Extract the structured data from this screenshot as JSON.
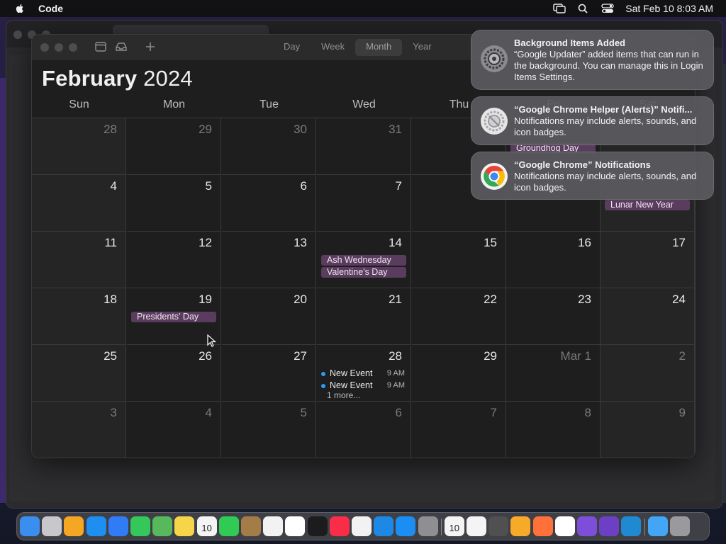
{
  "menubar": {
    "app_name": "Code",
    "clock": "Sat Feb 10  8:03 AM"
  },
  "calendar": {
    "view_tabs": [
      {
        "label": "Day",
        "active": false
      },
      {
        "label": "Week",
        "active": false
      },
      {
        "label": "Month",
        "active": true
      },
      {
        "label": "Year",
        "active": false
      }
    ],
    "month": "February",
    "year": "2024",
    "weekdays": [
      "Sun",
      "Mon",
      "Tue",
      "Wed",
      "Thu",
      "Fri",
      "Sat"
    ],
    "weeks": [
      [
        {
          "day": "28",
          "other": true
        },
        {
          "day": "29",
          "other": true
        },
        {
          "day": "30",
          "other": true
        },
        {
          "day": "31",
          "other": true
        },
        {
          "day": "",
          "other": false
        },
        {
          "day": "",
          "other": false,
          "events": [
            "Groundhog Day"
          ]
        },
        {
          "day": "",
          "other": false
        }
      ],
      [
        {
          "day": "4"
        },
        {
          "day": "5"
        },
        {
          "day": "6"
        },
        {
          "day": "7"
        },
        {
          "day": ""
        },
        {
          "day": ""
        },
        {
          "day": "",
          "events": [
            "Lunar New Year"
          ]
        }
      ],
      [
        {
          "day": "11"
        },
        {
          "day": "12"
        },
        {
          "day": "13"
        },
        {
          "day": "14",
          "events": [
            "Ash Wednesday",
            "Valentine's Day"
          ]
        },
        {
          "day": "15"
        },
        {
          "day": "16"
        },
        {
          "day": "17"
        }
      ],
      [
        {
          "day": "18"
        },
        {
          "day": "19",
          "events": [
            "Presidents' Day"
          ]
        },
        {
          "day": "20"
        },
        {
          "day": "21"
        },
        {
          "day": "22"
        },
        {
          "day": "23"
        },
        {
          "day": "24"
        }
      ],
      [
        {
          "day": "25"
        },
        {
          "day": "26"
        },
        {
          "day": "27"
        },
        {
          "day": "28",
          "timed": [
            {
              "title": "New Event",
              "time": "9 AM"
            },
            {
              "title": "New Event",
              "time": "9 AM"
            }
          ],
          "more": "1 more..."
        },
        {
          "day": "29"
        },
        {
          "day": "Mar 1",
          "other": true
        },
        {
          "day": "2",
          "other": true
        }
      ],
      [
        {
          "day": "3",
          "other": true
        },
        {
          "day": "4",
          "other": true
        },
        {
          "day": "5",
          "other": true
        },
        {
          "day": "6",
          "other": true
        },
        {
          "day": "7",
          "other": true
        },
        {
          "day": "8",
          "other": true
        },
        {
          "day": "9",
          "other": true
        }
      ]
    ]
  },
  "notifications": [
    {
      "icon": "system-settings-icon",
      "title": "Background Items Added",
      "body": "“Google Updater” added items that can run in the background. You can manage this in Login Items Settings."
    },
    {
      "icon": "chrome-helper-icon",
      "title": "“Google Chrome Helper (Alerts)” Notifi...",
      "body": "Notifications may include alerts, sounds, and icon badges."
    },
    {
      "icon": "chrome-icon",
      "title": "“Google Chrome” Notifications",
      "body": "Notifications may include alerts, sounds, and icon badges."
    }
  ],
  "dock": {
    "apps": [
      {
        "name": "finder-icon",
        "color": "#3a8ef0"
      },
      {
        "name": "launchpad-icon",
        "color": "#c7c7cc"
      },
      {
        "name": "photos-icon",
        "color": "#f5a623"
      },
      {
        "name": "safari-icon",
        "color": "#1f8ef1"
      },
      {
        "name": "mail-icon",
        "color": "#2f7cf6"
      },
      {
        "name": "messages-icon",
        "color": "#34c759"
      },
      {
        "name": "maps-icon",
        "color": "#58b85c"
      },
      {
        "name": "notes-icon",
        "color": "#f7d54a"
      },
      {
        "name": "calendar-icon",
        "color": "#f4f4f4"
      },
      {
        "name": "facetime-icon",
        "color": "#2fcb54"
      },
      {
        "name": "contacts-icon",
        "color": "#a47c48"
      },
      {
        "name": "reminders-icon",
        "color": "#f2f2f2"
      },
      {
        "name": "freeform-icon",
        "color": "#ffffff"
      },
      {
        "name": "appletv-icon",
        "color": "#1c1c1e"
      },
      {
        "name": "music-icon",
        "color": "#fa2d48"
      },
      {
        "name": "news-icon",
        "color": "#f2f2f2"
      },
      {
        "name": "keynote-icon",
        "color": "#1e88e5"
      },
      {
        "name": "appstore-icon",
        "color": "#1b8ef3"
      },
      {
        "name": "system-settings-icon",
        "color": "#8e8e93"
      },
      {
        "name": "calendar-2-icon",
        "color": "#f4f4f4"
      },
      {
        "name": "clock-icon",
        "color": "#f4f4f4"
      },
      {
        "name": "calculator-icon",
        "color": "#505050"
      },
      {
        "name": "home-icon",
        "color": "#f7a928"
      },
      {
        "name": "firefox-icon",
        "color": "#ff7139"
      },
      {
        "name": "chrome-icon",
        "color": "#ffffff"
      },
      {
        "name": "app-purple-icon",
        "color": "#7d4fd9"
      },
      {
        "name": "visual-studio-icon",
        "color": "#6c3fc4"
      },
      {
        "name": "vscode-icon",
        "color": "#1f8ad2"
      },
      {
        "name": "folder-icon",
        "color": "#42a5f5"
      },
      {
        "name": "trash-icon",
        "color": "#9a9a9e"
      }
    ],
    "calendar_date": "10"
  }
}
